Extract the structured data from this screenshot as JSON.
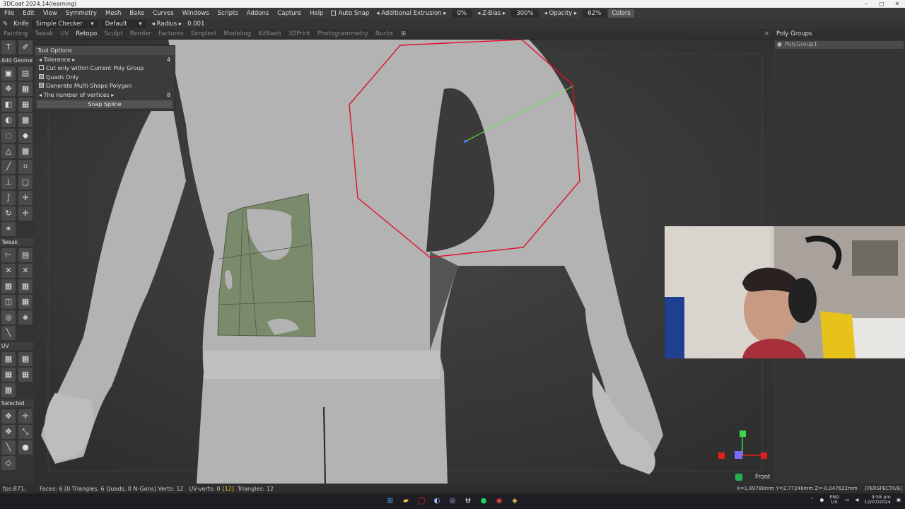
{
  "window": {
    "title": "3DCoat 2024.14(learning)",
    "minimize": "–",
    "maximize": "□",
    "close": "✕"
  },
  "menu": {
    "items": [
      "File",
      "Edit",
      "View",
      "Symmetry",
      "Mesh",
      "Bake",
      "Curves",
      "Windows",
      "Scripts",
      "Addons",
      "Capture",
      "Help"
    ],
    "auto_snap": "Auto Snap",
    "additional_extrusion": "Additional Extrusion",
    "extrusion_value": "0%",
    "zbias": "Z-Bias",
    "zbias_value": "300%",
    "opacity": "Opacity",
    "opacity_value": "62%",
    "colors": "Colors"
  },
  "toolbar": {
    "tool_name": "Knife",
    "checker_select": "Simple Checker",
    "default_select": "Default",
    "radius_label": "Radius",
    "radius_value": "0.001"
  },
  "tabs": [
    "Painting",
    "Tweak",
    "UV",
    "Retopo",
    "Sculpt",
    "Render",
    "Factures",
    "Simplest",
    "Modeling",
    "KitBash",
    "3DPrint",
    "Photogrammetry",
    "Nurbs"
  ],
  "active_tab": "Retopo",
  "left_sections": {
    "add_geometry": "Add Geome",
    "tweak": "Tweak",
    "uv": "UV",
    "selected": "Selected"
  },
  "tool_options": {
    "header": "Tool Options",
    "tolerance_label": "Tolerance",
    "tolerance_value": "4",
    "cut_only": "Cut only within Current Poly Group",
    "quads_only": "Quads Only",
    "generate_multi": "Generate Multi-Shape Polygon",
    "vertices_label": "The number of vertices",
    "vertices_value": "8",
    "snap_spline": "Snap Spline"
  },
  "poly_groups": {
    "header": "Poly Groups",
    "items": [
      "PolyGroup1"
    ]
  },
  "viewport": {
    "view_label": "Front",
    "gizmo": {
      "y": "Y",
      "z": "Z"
    }
  },
  "status": {
    "fps": "fps:871;",
    "faces": "Faces: 6 [0 Triangles, 6 Quads, 0 N-Gons] Verts: 12",
    "uv_verts": "UV-verts: 0",
    "uv_verts_bracket": "[12]",
    "triangles": "Triangles: 12",
    "coords": "X=1.89780mm  Y=2.77246mm  Z=-0.047622mm",
    "projection": "[PERSPECTIVE]"
  },
  "taskbar": {
    "lang": "ENG",
    "region": "US",
    "time": "9:58 pm",
    "date": "12/07/2024"
  },
  "colors": {
    "accent_red": "#e0102a",
    "patch_green": "#7c8a6c",
    "bg": "#3d3d3d"
  }
}
